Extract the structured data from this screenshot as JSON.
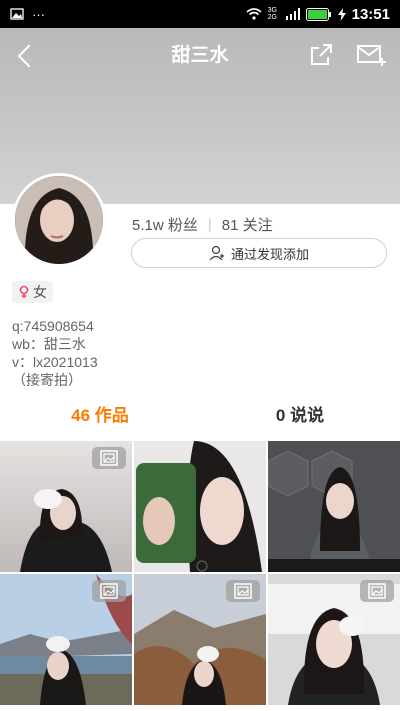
{
  "status_bar": {
    "time": "13:51",
    "network": "3G 2G"
  },
  "header": {
    "title": "甜三水"
  },
  "profile": {
    "followers": "5.1w 粉丝",
    "following": "81 关注",
    "discover_button": "通过发现添加",
    "gender": "女",
    "bio_lines": [
      "q:745908654",
      "wb：甜三水",
      "v：lx2021013",
      "（接寄拍）"
    ]
  },
  "tabs": [
    {
      "label": "46 作品"
    },
    {
      "label": "0 说说"
    }
  ],
  "icons": [
    "back-icon",
    "share-icon",
    "mail-icon",
    "gallery-icon",
    "user-add-icon",
    "female-icon"
  ],
  "accent_color": "#ff7a00"
}
